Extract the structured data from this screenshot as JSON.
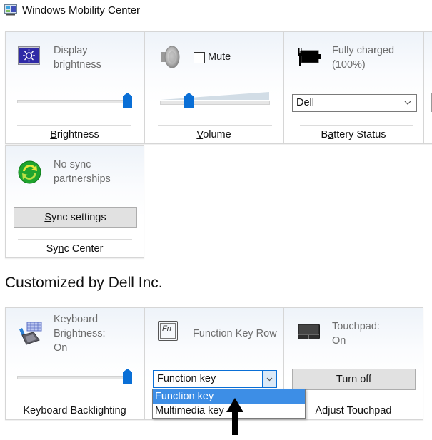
{
  "window": {
    "title": "Windows Mobility Center",
    "icon": "mobility-center-icon"
  },
  "tiles": {
    "brightness": {
      "icon": "display-brightness-icon",
      "status": [
        "Display",
        "brightness"
      ],
      "slider_value_percent": 100,
      "caption_pre": "",
      "caption_ul": "B",
      "caption_post": "rightness"
    },
    "volume": {
      "icon": "speaker-icon",
      "mute_label_ul": "M",
      "mute_label_post": "ute",
      "mute_checked": false,
      "slider_value_percent": 26,
      "caption_pre": "",
      "caption_ul": "V",
      "caption_post": "olume"
    },
    "battery": {
      "icon": "battery-charging-icon",
      "status": [
        "Fully charged",
        "(100%)"
      ],
      "power_plan_selected": "Dell",
      "caption_pre": "B",
      "caption_ul": "a",
      "caption_post": "ttery Status"
    },
    "sync": {
      "icon": "sync-icon",
      "status": [
        "No sync",
        "partnerships"
      ],
      "button_ul": "S",
      "button_post": "ync settings",
      "caption_pre": "Sy",
      "caption_ul": "n",
      "caption_post": "c Center"
    }
  },
  "section_title": "Customized by Dell Inc.",
  "dell_tiles": {
    "keyboard_backlight": {
      "icon": "keyboard-backlight-icon",
      "status": [
        "Keyboard",
        "Brightness:",
        "On"
      ],
      "slider_value_percent": 100,
      "caption": "Keyboard Backlighting"
    },
    "function_key_row": {
      "icon": "fn-key-icon",
      "icon_text": "Fn",
      "status": "Function Key Row",
      "selected": "Function key",
      "options": [
        "Function key",
        "Multimedia key"
      ],
      "highlighted_option": "Function key"
    },
    "touchpad": {
      "icon": "touchpad-icon",
      "status": [
        "Touchpad:",
        "On"
      ],
      "button": "Turn off",
      "caption": "Adjust Touchpad"
    }
  },
  "annotation": {
    "arrow": "up-arrow-annotation"
  },
  "colors": {
    "accent_blue": "#0a6fd6",
    "selection_blue": "#3d8ee6",
    "status_text_gray": "#6d6d6d"
  }
}
